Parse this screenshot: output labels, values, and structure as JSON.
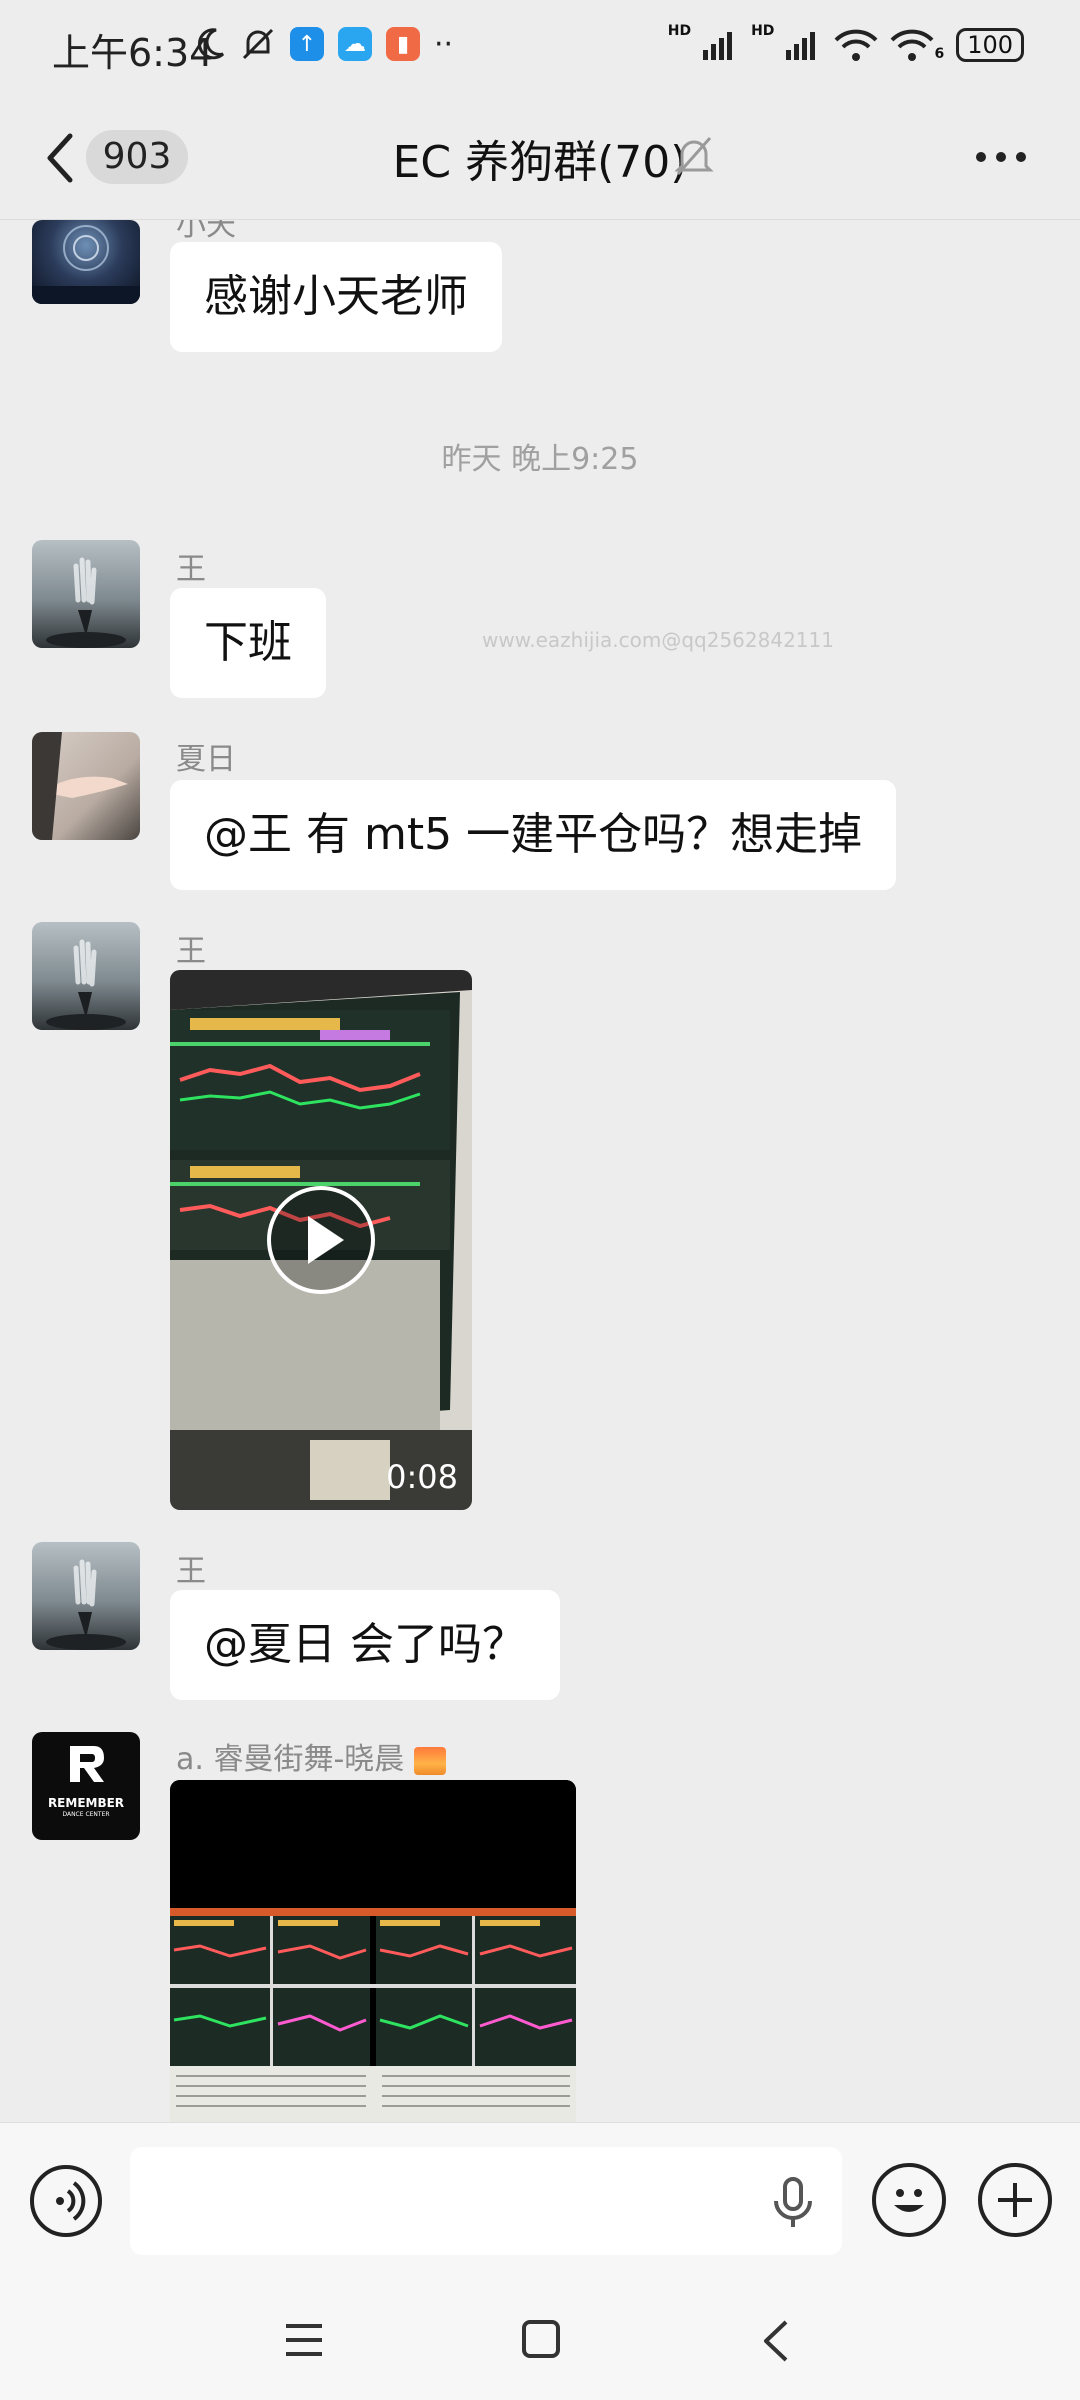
{
  "status_bar": {
    "time": "上午6:34",
    "signal_1": "HD",
    "signal_2": "HD",
    "wifi_badge": "6",
    "battery": "100",
    "more_dots": "··"
  },
  "header": {
    "unread_count": "903",
    "title": "EC 养狗群(70)"
  },
  "messages": {
    "m0": {
      "sender": "小天",
      "text": "感谢小天老师"
    },
    "timestamp": "昨天 晚上9:25",
    "m1": {
      "sender": "王",
      "text": "下班"
    },
    "m2": {
      "sender": "夏日",
      "text": "@王  有 mt5 一建平仓吗？想走掉"
    },
    "m3": {
      "sender": "王",
      "duration": "0:08"
    },
    "m4": {
      "sender": "王",
      "text": "@夏日  会了吗？"
    },
    "m5": {
      "sender": "a. 睿曼街舞-晓晨",
      "avatar_brand": "REMEMBER",
      "avatar_sub": "DANCE CENTER"
    }
  },
  "watermark": "www.eazhijia.com@qq2562842111",
  "input": {
    "value": "",
    "placeholder": ""
  },
  "colors": {
    "background": "#ededed",
    "bubble": "#ffffff",
    "muted_text": "#8a8a8a"
  },
  "icons": [
    "moon-icon",
    "mute-notification-icon",
    "signal-icon",
    "wifi-icon",
    "back-icon",
    "bell-muted-icon",
    "more-icon",
    "play-icon",
    "voice-icon",
    "mic-icon",
    "emoji-icon",
    "plus-icon",
    "menu-icon",
    "home-icon",
    "nav-back-icon"
  ]
}
